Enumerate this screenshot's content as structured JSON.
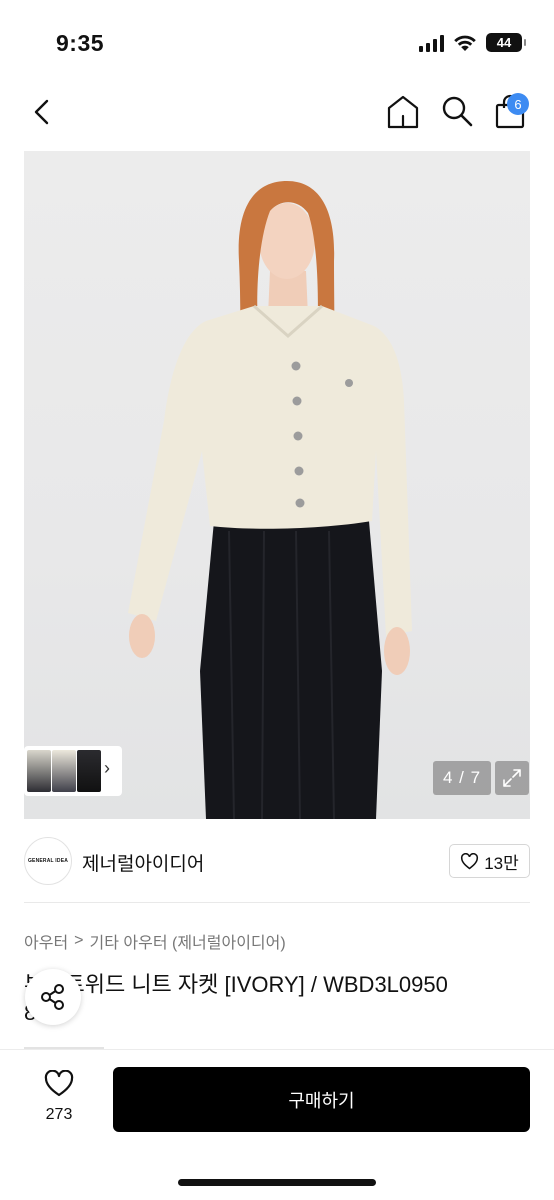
{
  "status": {
    "time": "9:35",
    "battery": "44"
  },
  "nav": {
    "cart_count": "6"
  },
  "gallery": {
    "page_indicator": "4 / 7"
  },
  "shop": {
    "logo_text": "GENERAL IDEA",
    "name": "제너럴아이디어",
    "likes": "13만"
  },
  "category": {
    "level1": "아우터",
    "separator": ">",
    "level2": "기타 아우터 (제너럴아이디어)"
  },
  "product": {
    "title_line1": "부클트위드 니트 자켓 [IVORY] / WBD3L0950",
    "title_line2": "8"
  },
  "bottom": {
    "favorite_count": "273",
    "buy_label": "구매하기"
  },
  "colors": {
    "accent_badge": "#3d8bf2",
    "buy_button": "#000000"
  },
  "icons": [
    "back-icon",
    "home-icon",
    "search-icon",
    "shopping-bag-icon",
    "expand-icon",
    "heart-icon",
    "share-icon",
    "chevron-right-icon"
  ]
}
